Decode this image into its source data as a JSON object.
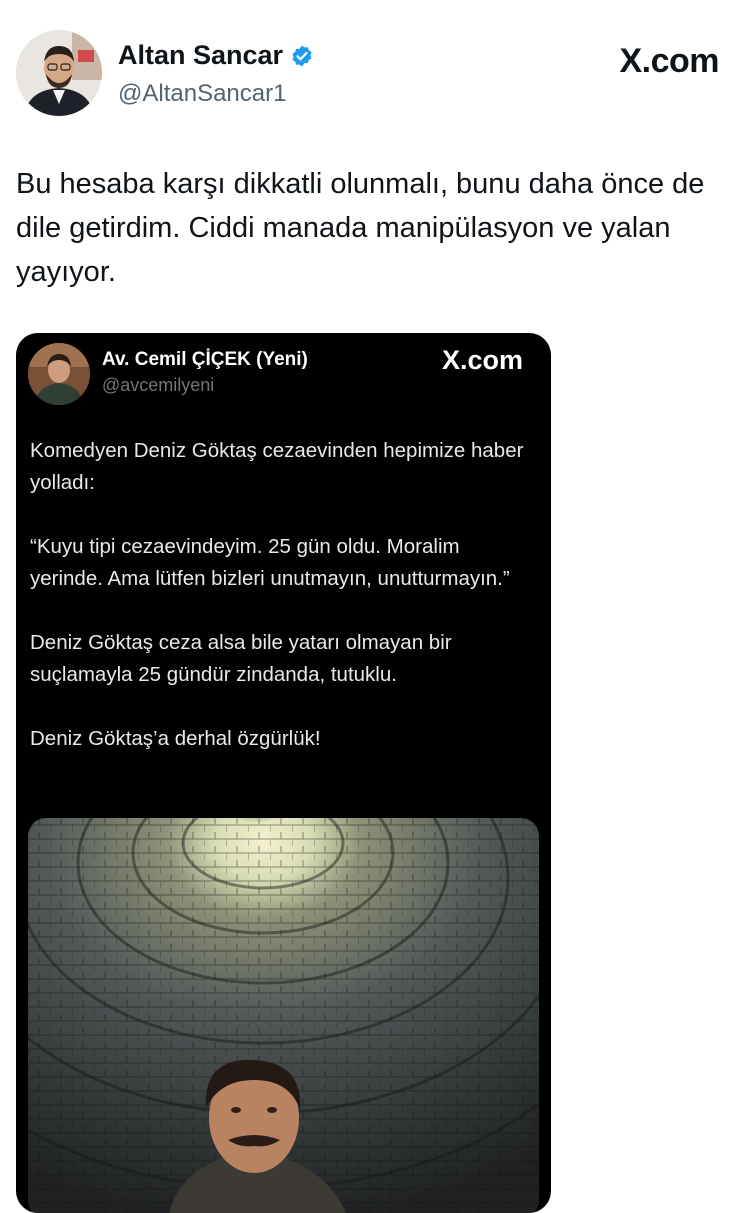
{
  "author": {
    "name": "Altan Sancar",
    "handle": "@AltanSancar1",
    "verified": true
  },
  "brand": "X.com",
  "tweet_text": "Bu hesaba karşı dikkatli olunmalı, bunu daha önce de dile getirdim. Ciddi manada manipülasyon ve yalan yayıyor.",
  "quoted": {
    "name": "Av. Cemil ÇİÇEK (Yeni)",
    "handle": "@avcemilyeni",
    "brand": "X.com",
    "paragraphs": [
      "Komedyen Deniz Göktaş cezaevinden hepimize haber yolladı:",
      "“Kuyu tipi cezaevindeyim. 25 gün oldu. Moralim yerinde. Ama lütfen bizleri unutmayın, unutturmayın.”",
      "Deniz Göktaş ceza alsa bile yatarı olmayan bir suçlamayla 25 gündür zindanda, tutuklu.",
      "Deniz Göktaş’a derhal özgürlük!"
    ],
    "image": "well-illustration-man-looking-up"
  },
  "colors": {
    "verified_blue": "#1d9bf0",
    "text_dark": "#0f1419",
    "handle_gray": "#536471",
    "card_bg": "#000000",
    "card_text": "#e7e9ea"
  }
}
